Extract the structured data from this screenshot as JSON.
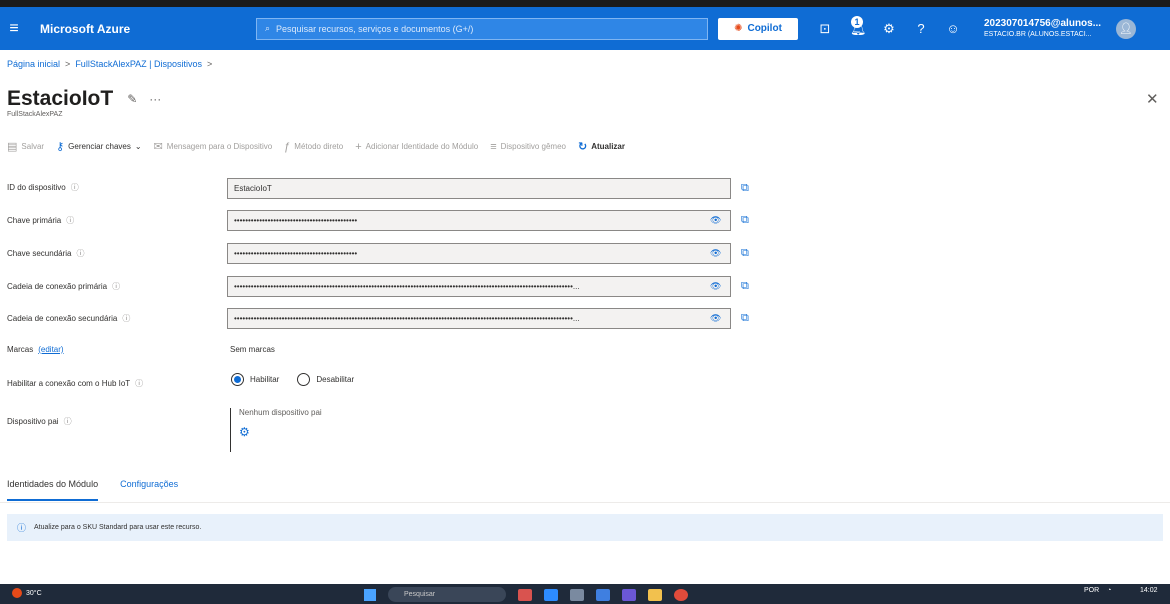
{
  "topbar": {
    "brand": "Microsoft Azure",
    "search_placeholder": "Pesquisar recursos, serviços e documentos (G+/)",
    "copilot": "Copilot",
    "notification_count": "1",
    "account_line1": "202307014756@alunos...",
    "account_line2": "ESTACIO.BR (ALUNOS.ESTACI...",
    "accent": "#0f6cd4"
  },
  "breadcrumb": [
    "Página inicial",
    "FullStackAlexPAZ | Dispositivos"
  ],
  "title": "EstacioIoT",
  "subtitle": "FullStackAlexPAZ",
  "commands": {
    "save": "Salvar",
    "manage_keys": "Gerenciar chaves",
    "message": "Mensagem para o Dispositivo",
    "direct_method": "Método direto",
    "add_module": "Adicionar Identidade do Módulo",
    "twin": "Dispositivo gêmeo",
    "refresh": "Atualizar"
  },
  "fields": {
    "device_id_label": "ID do dispositivo",
    "device_id_value": "EstacioIoT",
    "primary_key_label": "Chave primária",
    "primary_key_value": "••••••••••••••••••••••••••••••••••••••••••••",
    "secondary_key_label": "Chave secundária",
    "secondary_key_value": "••••••••••••••••••••••••••••••••••••••••••••",
    "primary_conn_label": "Cadeia de conexão primária",
    "primary_conn_value": "•••••••••••••••••••••••••••••••••••••••••••••••••••••••••••••••••••••••••••••••••••••••••••••••••••••••••••••••••••••••••...",
    "secondary_conn_label": "Cadeia de conexão secundária",
    "secondary_conn_value": "•••••••••••••••••••••••••••••••••••••••••••••••••••••••••••••••••••••••••••••••••••••••••••••••••••••••••••••••••••••••••...",
    "tags_label": "Marcas",
    "tags_edit": "(editar)",
    "tags_value": "Sem marcas",
    "hub_label": "Habilitar a conexão com o Hub IoT",
    "enable": "Habilitar",
    "disable": "Desabilitar",
    "parent_label": "Dispositivo pai",
    "parent_value": "Nenhum dispositivo pai"
  },
  "tabs": [
    "Identidades do Módulo",
    "Configurações"
  ],
  "banner": "Atualize para o SKU Standard para usar este recurso.",
  "taskbar": {
    "weather": "30°C",
    "search": "Pesquisar",
    "lang": "POR",
    "time": "14:02"
  }
}
